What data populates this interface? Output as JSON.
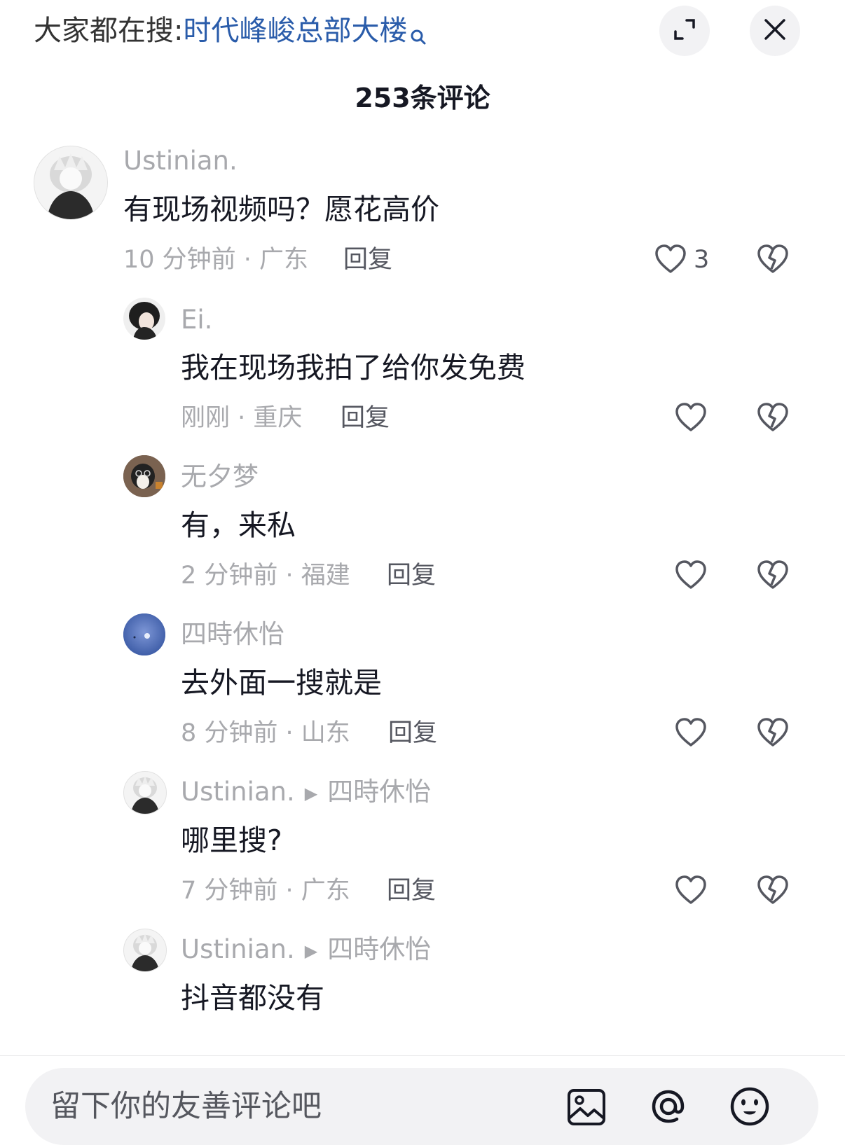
{
  "search_hint": {
    "prefix": "大家都在搜",
    "colon": ":",
    "query": "时代峰峻总部大楼"
  },
  "header": {
    "title": "253条评论"
  },
  "comments": [
    {
      "username": "Ustinian.",
      "content": "有现场视频吗？愿花高价",
      "meta": "10 分钟前 · 广东",
      "reply_label": "回复",
      "likes": "3"
    },
    {
      "username": "Ei.",
      "content": "我在现场我拍了给你发免费",
      "meta": "刚刚 · 重庆",
      "reply_label": "回复"
    },
    {
      "username": "无夕梦",
      "content": "有，来私",
      "meta": "2 分钟前 · 福建",
      "reply_label": "回复"
    },
    {
      "username": "四時休怡",
      "content": "去外面一搜就是",
      "meta": "8 分钟前 · 山东",
      "reply_label": "回复"
    },
    {
      "username": "Ustinian.",
      "reply_to": "四時休怡",
      "content": "哪里搜?",
      "meta": "7 分钟前 · 广东",
      "reply_label": "回复"
    },
    {
      "username": "Ustinian.",
      "reply_to": "四時休怡",
      "content": "抖音都没有"
    }
  ],
  "input": {
    "placeholder": "留下你的友善评论吧"
  },
  "icons": {
    "expand": "expand-icon",
    "close": "close-icon",
    "like": "heart-icon",
    "dislike": "broken-heart-icon",
    "image": "image-icon",
    "mention": "at-icon",
    "emoji": "emoji-icon"
  },
  "colors": {
    "query_link": "#2a5caa",
    "muted_text": "#a8a9ad",
    "primary_text": "#161823"
  }
}
